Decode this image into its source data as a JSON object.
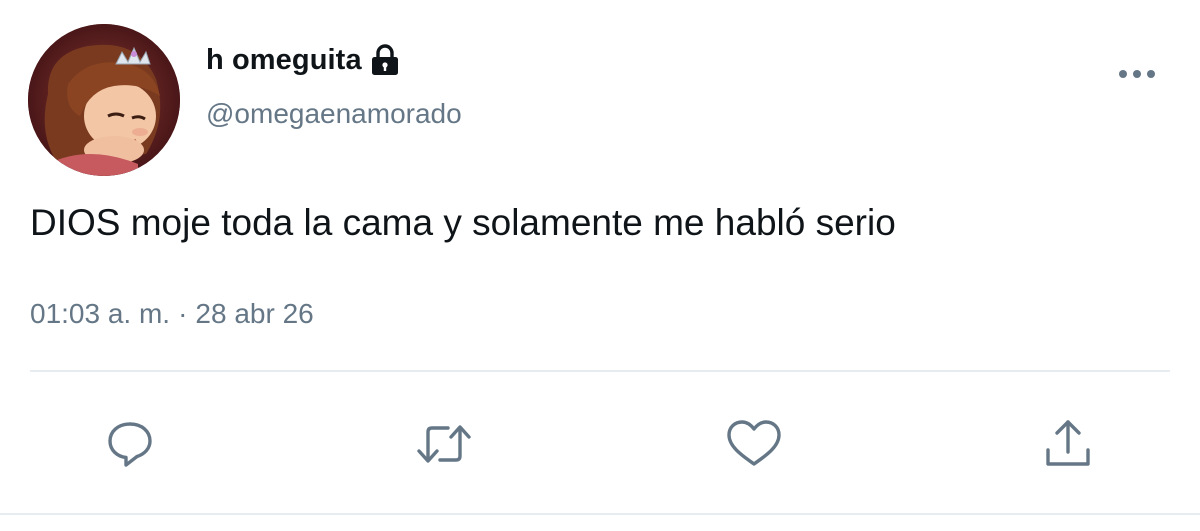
{
  "tweet": {
    "display_name": "h omeguita",
    "handle": "@omegaenamorado",
    "text": "DIOS moje toda la cama y solamente me habló serio",
    "time": "01:03 a. m.",
    "separator": "·",
    "date": "28 abr 26",
    "protected": true
  },
  "icons": {
    "lock": "lock-icon",
    "more": "more-icon",
    "reply": "reply-icon",
    "retweet": "retweet-icon",
    "like": "like-icon",
    "share": "share-icon"
  },
  "colors": {
    "text": "#0f1419",
    "secondary": "#657786",
    "divider": "#e6ecf0",
    "avatar_bg": "#5a1b1e"
  }
}
